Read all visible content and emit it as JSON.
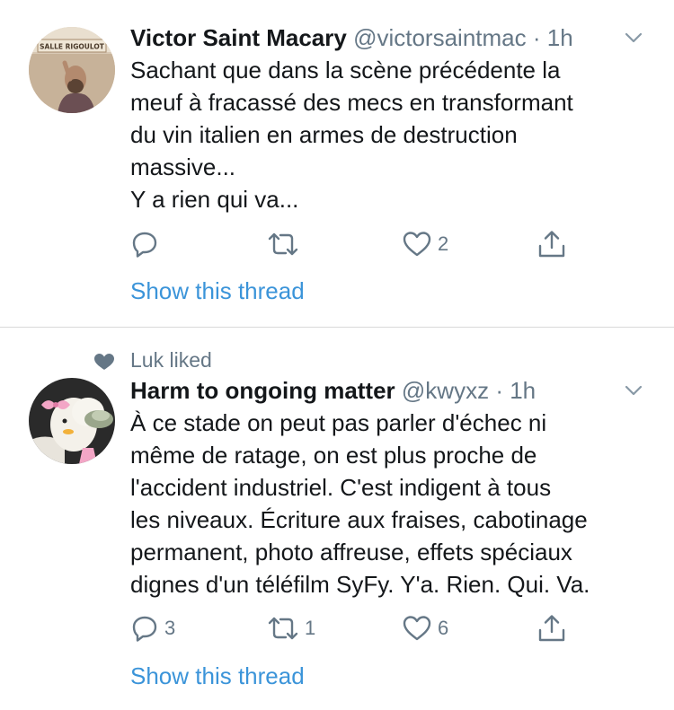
{
  "tweets": [
    {
      "author_name": "Victor Saint Macary",
      "handle": "@victorsaintmac",
      "separator": "·",
      "time": "1h",
      "avatar_sign_text": "SALLE RIGOULOT",
      "text_lines": [
        "Sachant que dans la scène précédente la",
        "meuf à fracassé des mecs en transformant",
        "du vin italien en armes de destruction",
        "massive...",
        "Y a rien qui va..."
      ],
      "replies": "",
      "retweets": "",
      "likes": "2",
      "show_thread": "Show this thread"
    },
    {
      "social_context": "Luk liked",
      "author_name": "Harm to ongoing matter",
      "handle": "@kwyxz",
      "separator": "·",
      "time": "1h",
      "text_lines": [
        "À ce stade on peut pas parler d'échec ni",
        "même de ratage, on est plus proche de",
        "l'accident industriel. C'est indigent à tous",
        "les niveaux. Écriture aux fraises, cabotinage",
        "permanent, photo affreuse, effets spéciaux",
        "dignes d'un téléfilm SyFy. Y'a. Rien. Qui. Va."
      ],
      "replies": "3",
      "retweets": "1",
      "likes": "6",
      "show_thread": "Show this thread"
    }
  ],
  "colors": {
    "text": "#14171a",
    "secondary": "#657786",
    "link": "#3b94d9",
    "divider": "#d9d9d9"
  },
  "icons": {
    "reply": "reply-icon",
    "retweet": "retweet-icon",
    "like": "heart-icon",
    "share": "share-icon",
    "menu": "chevron-down-icon",
    "social_context": "heart-filled-icon"
  }
}
